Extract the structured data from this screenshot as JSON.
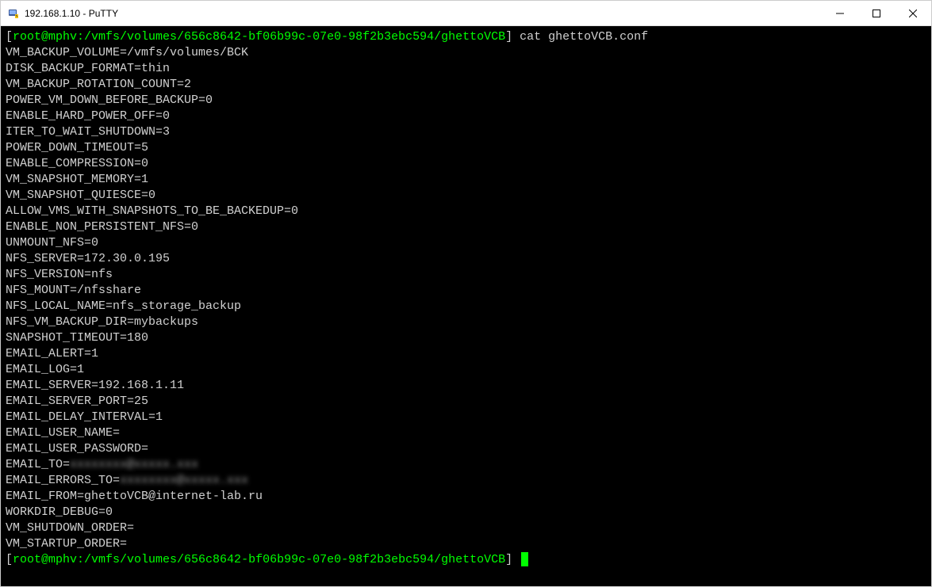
{
  "window": {
    "title": "192.168.1.10 - PuTTY"
  },
  "terminal": {
    "prompt": {
      "open": "[",
      "inner": "root@mphv:/vmfs/volumes/656c8642-bf06b99c-07e0-98f2b3ebc594/ghettoVCB",
      "close": "]"
    },
    "command1": " cat ghettoVCB.conf",
    "lines": [
      "VM_BACKUP_VOLUME=/vmfs/volumes/BCK",
      "DISK_BACKUP_FORMAT=thin",
      "VM_BACKUP_ROTATION_COUNT=2",
      "POWER_VM_DOWN_BEFORE_BACKUP=0",
      "ENABLE_HARD_POWER_OFF=0",
      "ITER_TO_WAIT_SHUTDOWN=3",
      "POWER_DOWN_TIMEOUT=5",
      "ENABLE_COMPRESSION=0",
      "VM_SNAPSHOT_MEMORY=1",
      "VM_SNAPSHOT_QUIESCE=0",
      "ALLOW_VMS_WITH_SNAPSHOTS_TO_BE_BACKEDUP=0",
      "ENABLE_NON_PERSISTENT_NFS=0",
      "UNMOUNT_NFS=0",
      "NFS_SERVER=172.30.0.195",
      "NFS_VERSION=nfs",
      "NFS_MOUNT=/nfsshare",
      "NFS_LOCAL_NAME=nfs_storage_backup",
      "NFS_VM_BACKUP_DIR=mybackups",
      "SNAPSHOT_TIMEOUT=180",
      "EMAIL_ALERT=1",
      "EMAIL_LOG=1",
      "EMAIL_SERVER=192.168.1.11",
      "EMAIL_SERVER_PORT=25",
      "EMAIL_DELAY_INTERVAL=1",
      "EMAIL_USER_NAME=",
      "EMAIL_USER_PASSWORD="
    ],
    "email_to_label": "EMAIL_TO=",
    "email_to_value": "xxxxxxxx@xxxxx.xxx",
    "email_errors_label": "EMAIL_ERRORS_TO=",
    "email_errors_value": "xxxxxxxx@xxxxx.xxx",
    "lines2": [
      "EMAIL_FROM=ghettoVCB@internet-lab.ru",
      "WORKDIR_DEBUG=0",
      "VM_SHUTDOWN_ORDER=",
      "VM_STARTUP_ORDER="
    ]
  }
}
